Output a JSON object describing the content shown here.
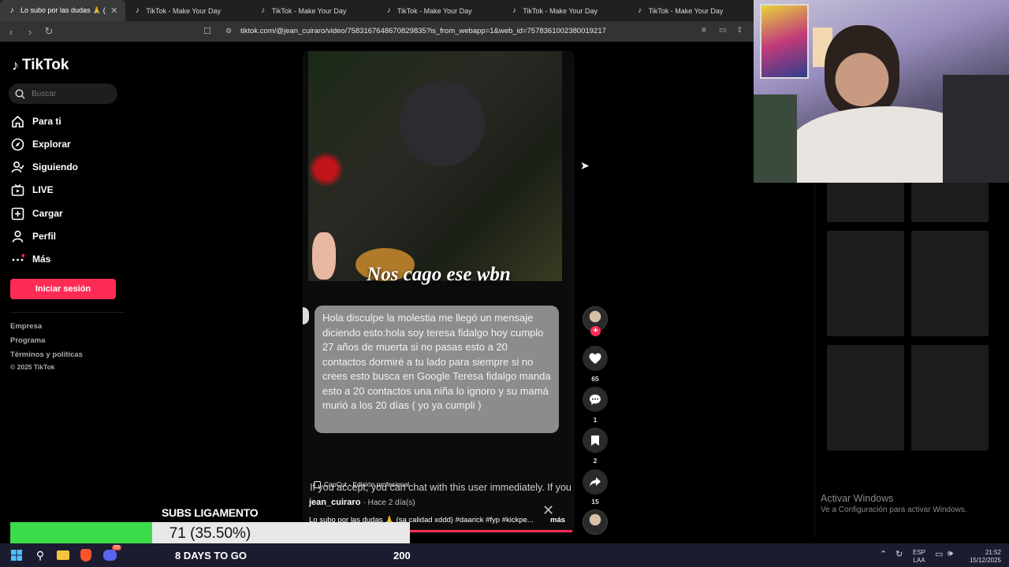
{
  "browser": {
    "tabs": [
      {
        "label": "Lo subo por las dudas 🙏 (sa calidad xddd)",
        "active": true
      },
      {
        "label": "TikTok - Make Your Day"
      },
      {
        "label": "TikTok - Make Your Day"
      },
      {
        "label": "TikTok - Make Your Day"
      },
      {
        "label": "TikTok - Make Your Day"
      },
      {
        "label": "TikTok - Make Your Day"
      }
    ],
    "url": "tiktok.com/@jean_cuiraro/video/7583167648670829835?is_from_webapp=1&web_id=7578361002380019217"
  },
  "sidebar": {
    "logo": "TikTok",
    "search_placeholder": "Buscar",
    "items": [
      {
        "label": "Para ti",
        "icon": "home-icon"
      },
      {
        "label": "Explorar",
        "icon": "compass-icon"
      },
      {
        "label": "Siguiendo",
        "icon": "following-icon"
      },
      {
        "label": "LIVE",
        "icon": "live-icon"
      },
      {
        "label": "Cargar",
        "icon": "upload-icon"
      },
      {
        "label": "Perfil",
        "icon": "profile-icon"
      },
      {
        "label": "Más",
        "icon": "more-icon"
      }
    ],
    "login_button": "Iniciar sesión",
    "footer": [
      "Empresa",
      "Programa",
      "Términos y políticas",
      "© 2025 TikTok"
    ]
  },
  "video": {
    "caption": "Nos cago ese wbn",
    "message": "Hola disculpe la molestia me llegó un mensaje diciendo esto:hola soy teresa fidalgo hoy cumplo 27 años de muerta si no pasas esto a 20 contactos dormiré a tu lado para siempre si no crees esto busca en Google Teresa fidalgo manda esto a 20 contactos una niña lo ignoro y su mamá murió a los 20 días ( yo ya cumpli )",
    "ghost_text": "If you accept, you can chat with this user immediately. If you",
    "capcut_label": "CapCut · Edición profesional",
    "author": "jean_cuiraro",
    "posted": "· Hace 2 día(s)",
    "description": "Lo subo por las dudas 🙏 (sa calidad xddd) #daarick #fyp #kickpe...",
    "more": "más",
    "likes": "65",
    "comments": "1",
    "saves": "2",
    "shares": "15"
  },
  "desktop": {
    "activate_title": "Activar Windows",
    "activate_sub": "Ve a Configuración para activar Windows."
  },
  "overlay": {
    "subs_label": "SUBS LIGAMENTO",
    "goal_text": "71 (35.50%)",
    "goal_progress": 0.355,
    "days_left": "8 DAYS TO GO",
    "goal_target": "200"
  },
  "taskbar": {
    "lang": "ESP",
    "lang_sub": "LAA",
    "time": "21:52",
    "date": "15/12/2025",
    "badge": "99"
  },
  "colors": {
    "accent": "#fe2c55",
    "goal_fill": "#3ddc4a"
  }
}
